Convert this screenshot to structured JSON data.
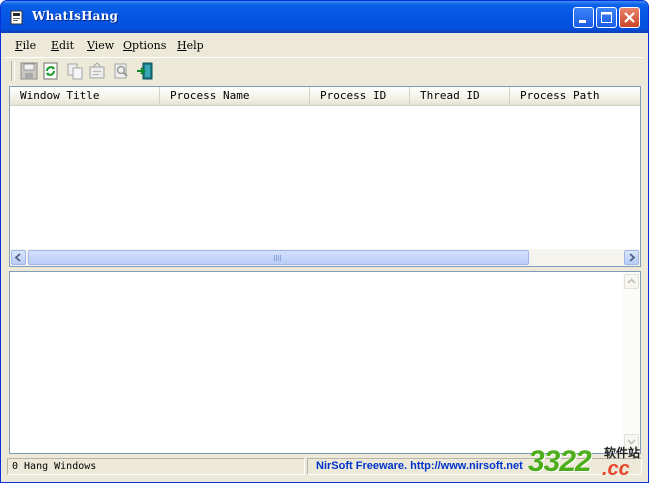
{
  "window": {
    "title": "WhatIsHang"
  },
  "menu": {
    "items": [
      {
        "key": "F",
        "rest": "ile"
      },
      {
        "key": "E",
        "rest": "dit"
      },
      {
        "key": "V",
        "rest": "iew"
      },
      {
        "key": "O",
        "rest": "ptions"
      },
      {
        "key": "H",
        "rest": "elp"
      }
    ]
  },
  "toolbar": {
    "icons": [
      "save-icon",
      "refresh-icon",
      "copy-icon",
      "properties-icon",
      "find-icon",
      "exit-icon"
    ]
  },
  "table": {
    "columns": [
      "Window Title",
      "Process Name",
      "Process ID",
      "Thread ID",
      "Process Path"
    ]
  },
  "status": {
    "count": "0 Hang Windows",
    "credit": "NirSoft Freeware.  http://www.nirsoft.net"
  },
  "watermark": {
    "number": "3322",
    "domain": ".cc",
    "chinese": "软件站"
  },
  "colors": {
    "titlebar": "#0554e3",
    "link": "#0033cc",
    "watermark_green": "#4cae1a",
    "watermark_red": "#e8472c"
  }
}
